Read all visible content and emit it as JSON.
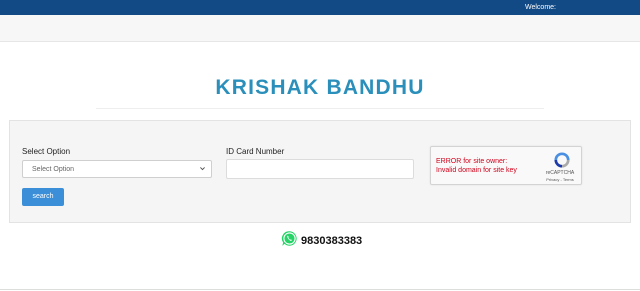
{
  "header": {
    "welcome": "Welcome:"
  },
  "title": "KRISHAK BANDHU",
  "form": {
    "select_label": "Select Option",
    "select_value": "Select Option",
    "id_label": "ID Card Number",
    "id_value": "",
    "search_label": "search"
  },
  "recaptcha": {
    "error_line1": "ERROR for site owner:",
    "error_line2": "Invalid domain for site key",
    "brand": "reCAPTCHA",
    "privacy": "Privacy",
    "separator": " - ",
    "terms": "Terms"
  },
  "contact": {
    "phone": "9830383383",
    "icon": "whatsapp-icon"
  },
  "colors": {
    "topbar": "#124a85",
    "title": "#2a8fba",
    "button": "#3a8fd8",
    "error": "#d0021b",
    "whatsapp": "#25d366"
  }
}
